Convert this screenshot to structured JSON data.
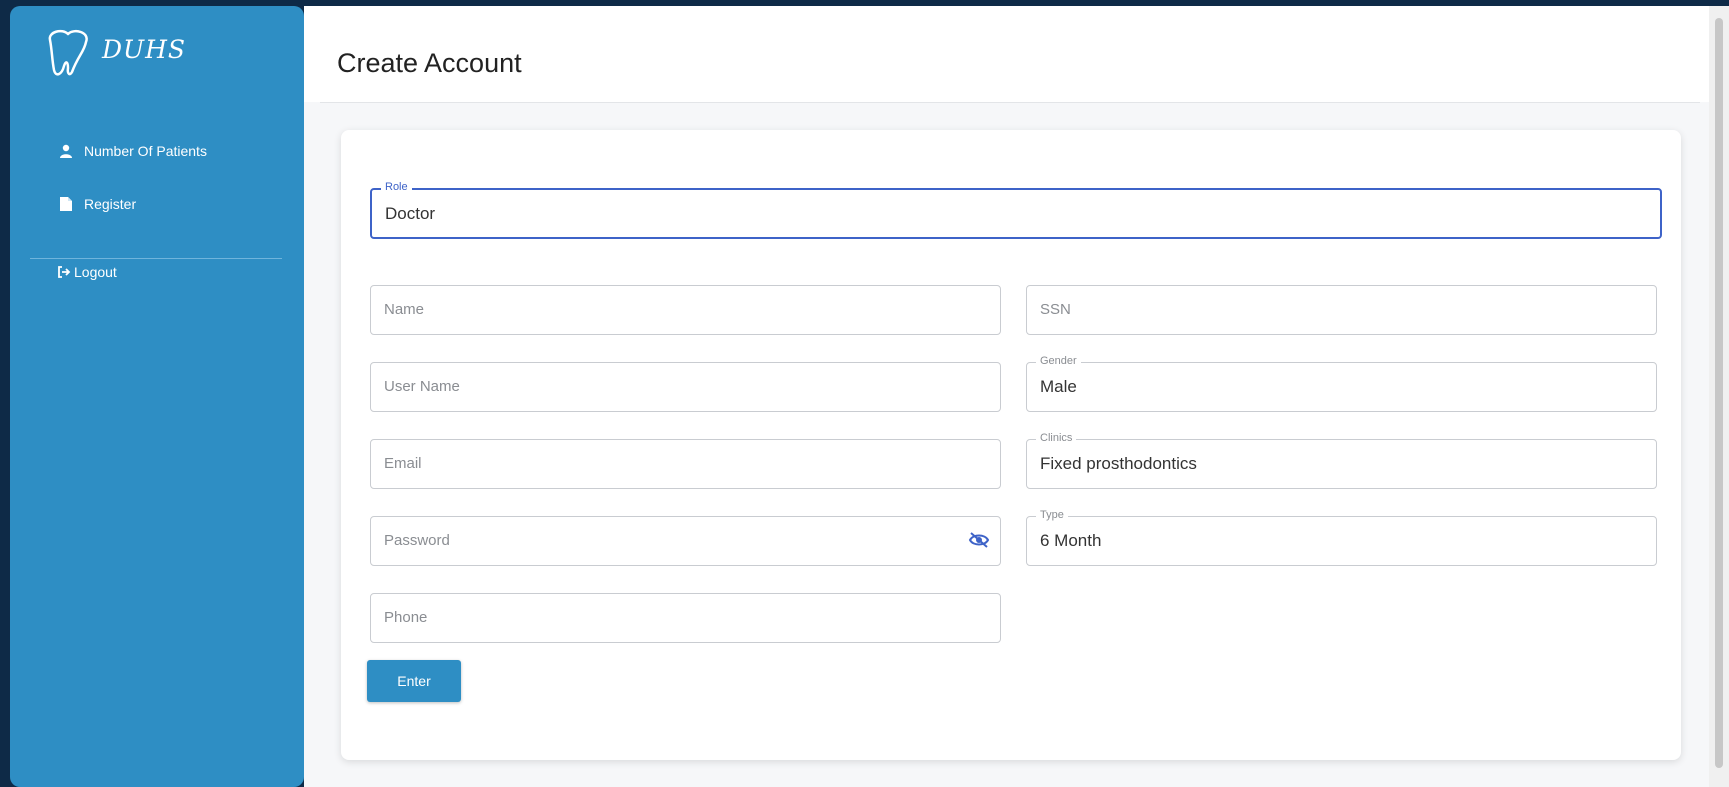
{
  "app": {
    "logo_text": "DUHS"
  },
  "sidebar": {
    "items": [
      {
        "label": "Number Of Patients",
        "icon": "user-icon"
      },
      {
        "label": "Register",
        "icon": "file-icon"
      },
      {
        "label": "Logout",
        "icon": "logout-icon"
      }
    ]
  },
  "page": {
    "title": "Create Account"
  },
  "form": {
    "role": {
      "legend": "Role",
      "value": "Doctor"
    },
    "name": {
      "placeholder": "Name"
    },
    "ssn": {
      "placeholder": "SSN"
    },
    "username": {
      "placeholder": "User Name"
    },
    "gender": {
      "legend": "Gender",
      "value": "Male"
    },
    "email": {
      "placeholder": "Email"
    },
    "clinics": {
      "legend": "Clinics",
      "value": "Fixed prosthodontics"
    },
    "password": {
      "placeholder": "Password"
    },
    "type": {
      "legend": "Type",
      "value": "6 Month"
    },
    "phone": {
      "placeholder": "Phone"
    },
    "submit_label": "Enter"
  },
  "colors": {
    "sidebar": "#2e8ec4",
    "accent": "#3e63c8",
    "background": "#0e2a47"
  }
}
